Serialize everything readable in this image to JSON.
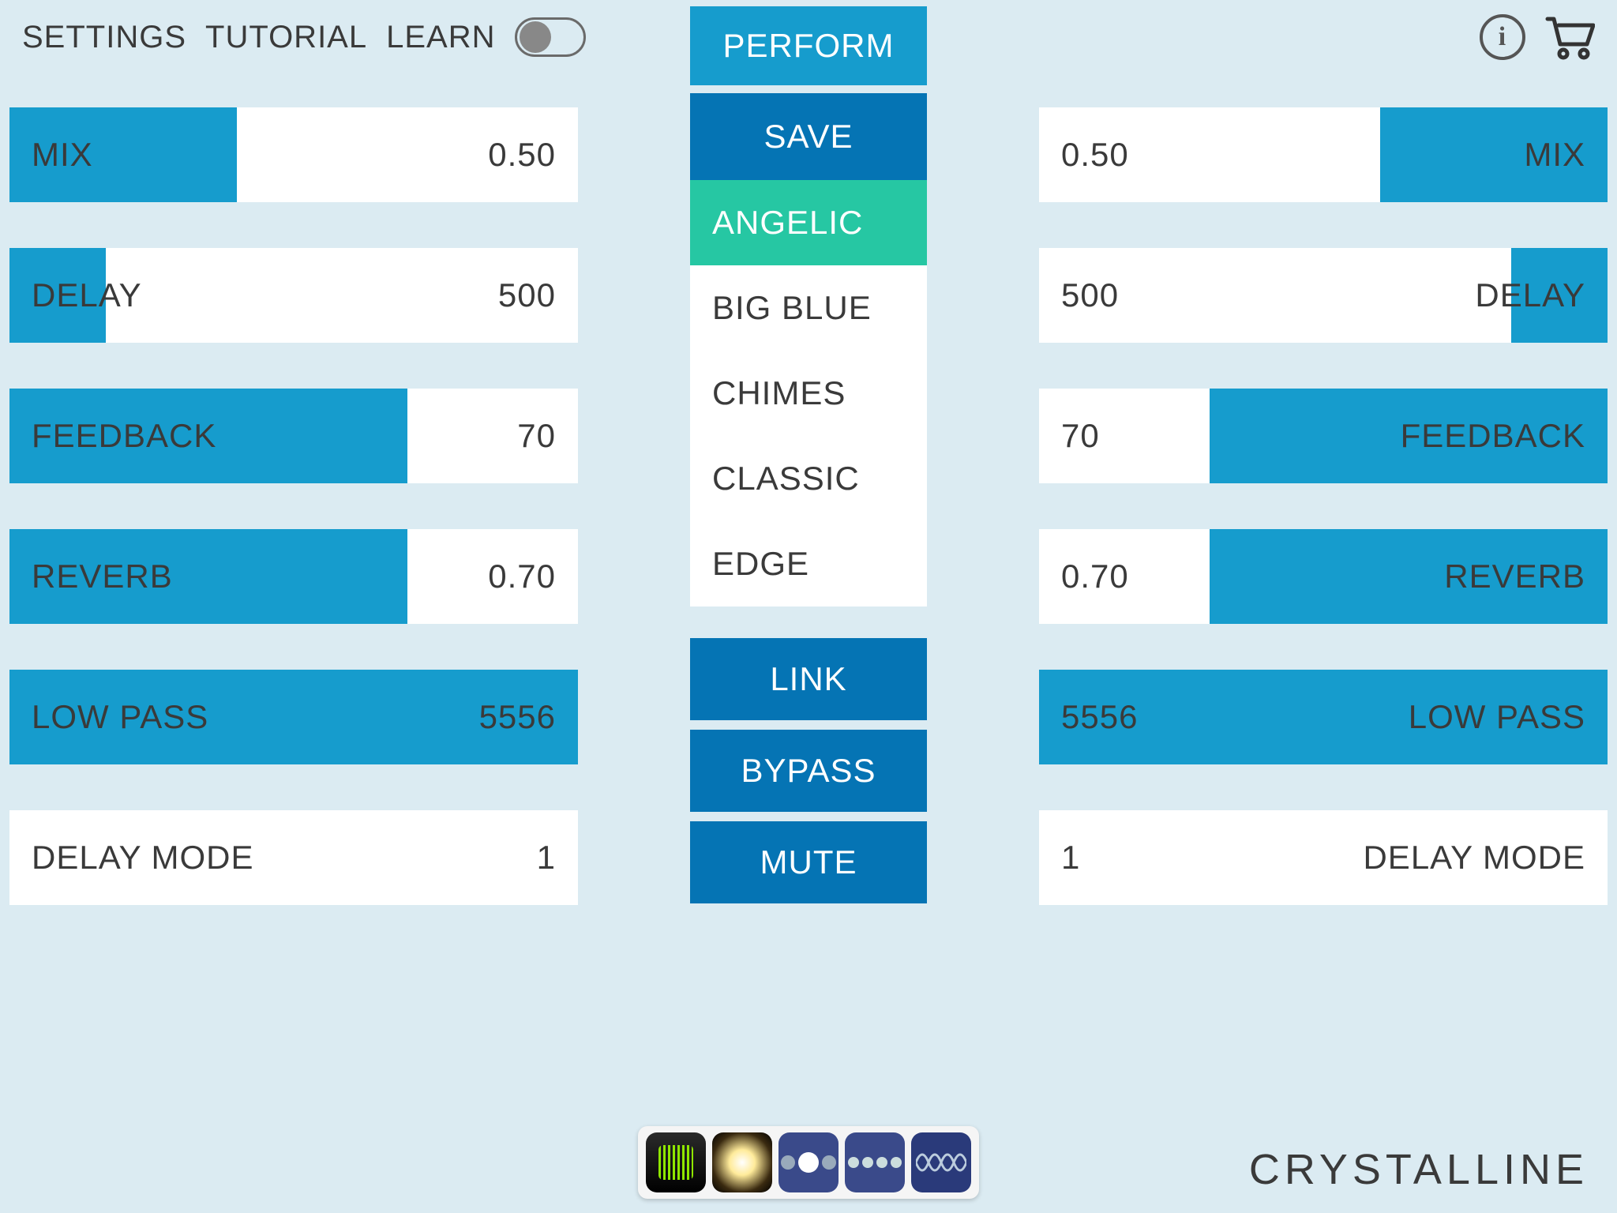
{
  "header": {
    "settings": "SETTINGS",
    "tutorial": "TUTORIAL",
    "learn": "LEARN"
  },
  "center": {
    "perform": "PERFORM",
    "save": "SAVE",
    "presets": [
      "ANGELIC",
      "BIG BLUE",
      "CHIMES",
      "CLASSIC",
      "EDGE"
    ],
    "selected_preset": 0,
    "link": "LINK",
    "bypass": "BYPASS",
    "mute": "MUTE"
  },
  "params_left": [
    {
      "label": "MIX",
      "value": "0.50",
      "fill": 40
    },
    {
      "label": "DELAY",
      "value": "500",
      "fill": 17
    },
    {
      "label": "FEEDBACK",
      "value": "70",
      "fill": 70
    },
    {
      "label": "REVERB",
      "value": "0.70",
      "fill": 70
    },
    {
      "label": "LOW PASS",
      "value": "5556",
      "fill": 100
    },
    {
      "label": "DELAY MODE",
      "value": "1",
      "fill": 0
    }
  ],
  "params_right": [
    {
      "label": "MIX",
      "value": "0.50",
      "fill": 40
    },
    {
      "label": "DELAY",
      "value": "500",
      "fill": 17
    },
    {
      "label": "FEEDBACK",
      "value": "70",
      "fill": 70
    },
    {
      "label": "REVERB",
      "value": "0.70",
      "fill": 70
    },
    {
      "label": "LOW PASS",
      "value": "5556",
      "fill": 100
    },
    {
      "label": "DELAY MODE",
      "value": "1",
      "fill": 0
    }
  ],
  "app_name": "CRYSTALLINE"
}
